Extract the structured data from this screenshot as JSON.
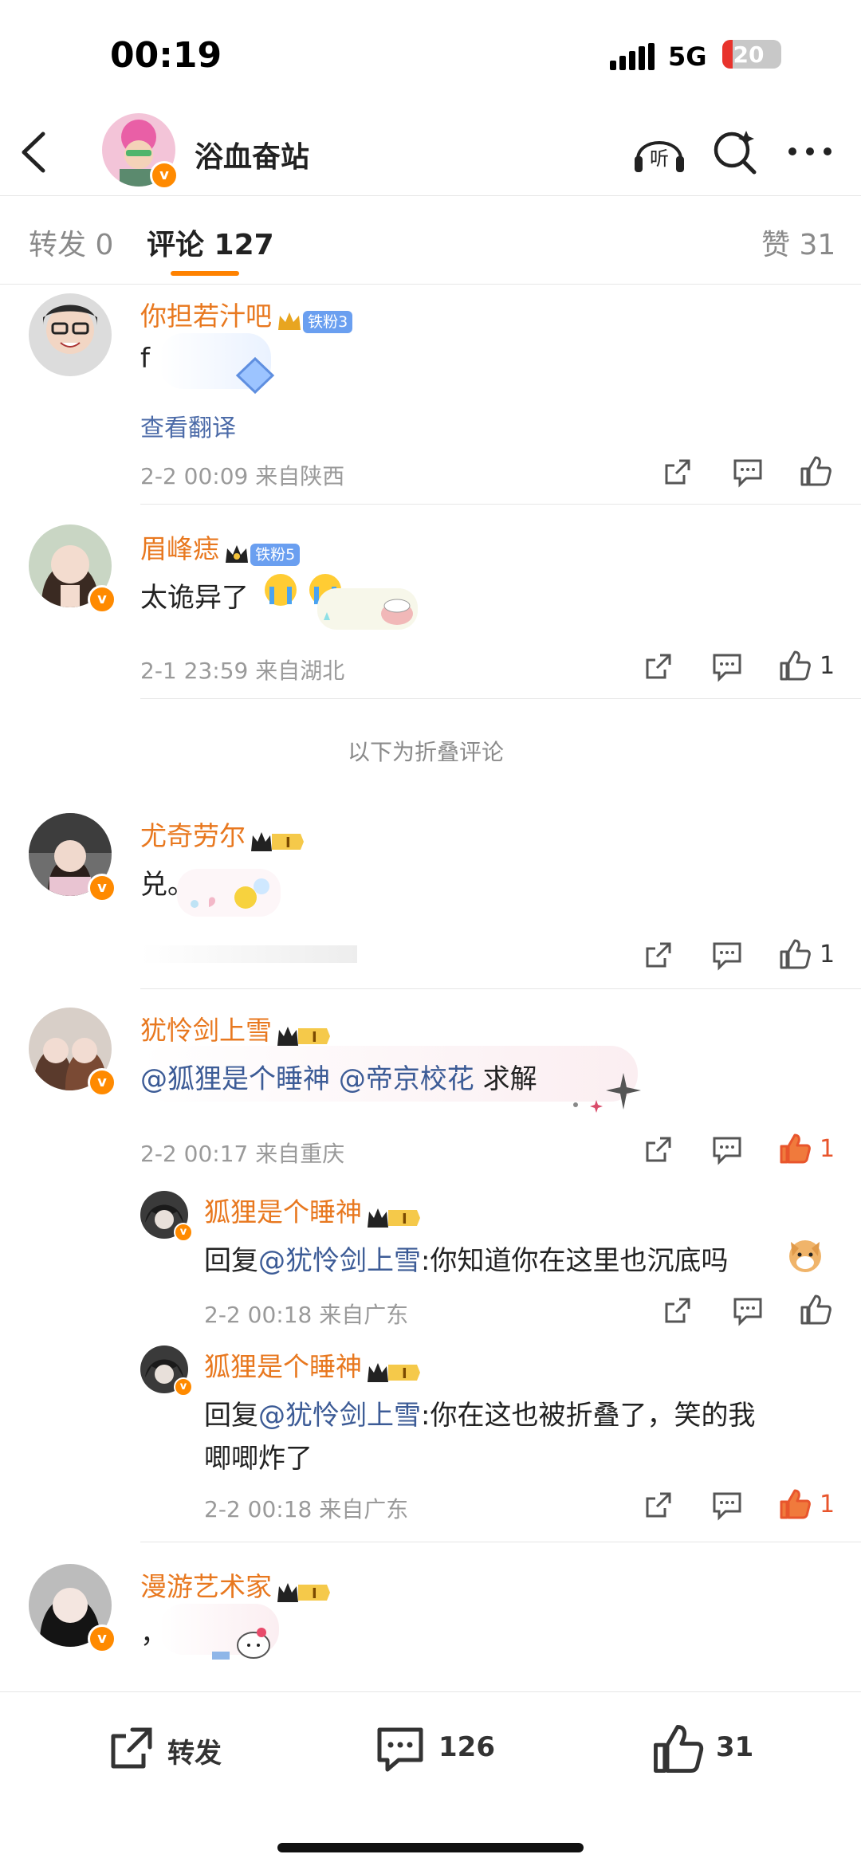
{
  "status_bar": {
    "time": "00:19",
    "network": "5G",
    "battery": "20"
  },
  "header": {
    "title": "浴血奋站"
  },
  "tabs": [
    {
      "label": "转发 0"
    },
    {
      "label": "评论 127"
    },
    {
      "label": "赞 31"
    }
  ],
  "comments": [
    {
      "name": "你担若汁吧",
      "badge": "铁粉3",
      "text": "f",
      "translate": "查看翻译",
      "meta": "2-2 00:09  来自陕西",
      "likes": ""
    },
    {
      "name": "眉峰痣",
      "badge": "铁粉5",
      "text": "太诡异了",
      "meta": "2-1 23:59  来自湖北",
      "likes": "1"
    },
    {
      "name": "尤奇劳尔",
      "text": "兑。",
      "meta": "",
      "likes": "1"
    },
    {
      "name": "犹怜剑上雪",
      "mention1": "@狐狸是个睡神",
      "mention2": "@帝京校花",
      "text_tail": "求解",
      "meta": "2-2 00:17  来自重庆",
      "likes": "1"
    },
    {
      "name": "漫游艺术家",
      "text": "，"
    }
  ],
  "fold_notice": "以下为折叠评论",
  "replies": [
    {
      "name": "狐狸是个睡神",
      "prefix": "回复",
      "mention": "@犹怜剑上雪",
      "text": ":你知道你在这里也沉底吗",
      "meta": "2-2 00:18  来自广东",
      "likes": ""
    },
    {
      "name": "狐狸是个睡神",
      "prefix": "回复",
      "mention": "@犹怜剑上雪",
      "text": ":你在这也被折叠了，笑的我",
      "text2": "唧唧炸了",
      "meta": "2-2 00:18  来自广东",
      "likes": "1"
    }
  ],
  "bottom_bar": {
    "repost": "转发",
    "comments": "126",
    "likes": "31"
  },
  "colors": {
    "accent": "#ff8200",
    "username": "#e8781f",
    "mention": "#3c5b96",
    "like_active": "#e8552c"
  }
}
